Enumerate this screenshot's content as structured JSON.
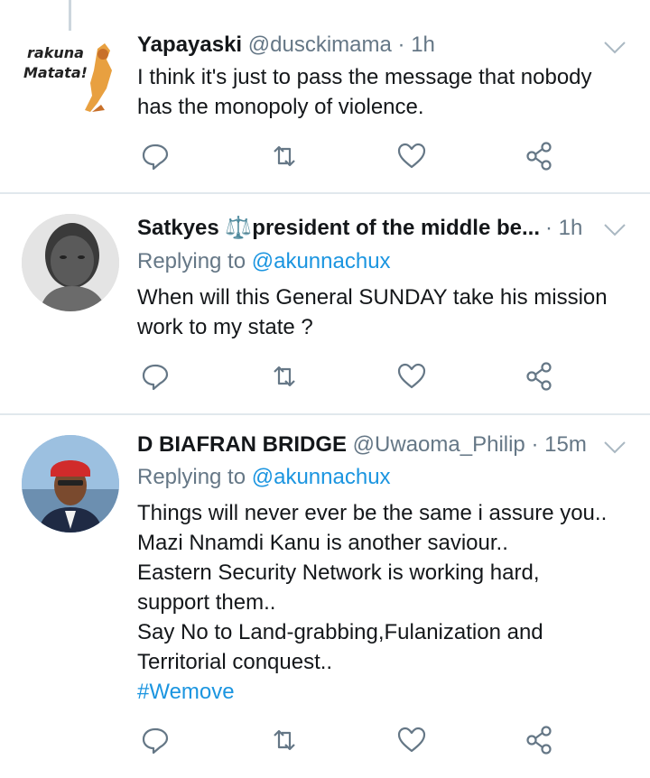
{
  "tweets": [
    {
      "name": "Yapayaski",
      "handle": "@dusckimama",
      "time": "1h",
      "avatar_text_1": "rakuna",
      "avatar_text_2": "Matata!",
      "lines": [
        "I think it's just to pass the message that nobody",
        "has the monopoly of violence."
      ]
    },
    {
      "name": "Satkyes ⚖️president of the middle be...",
      "handle": "",
      "time": "1h",
      "reply_prefix": "Replying to",
      "reply_handle": "@akunnachux",
      "lines": [
        "When will this General SUNDAY take his mission",
        "work to my state ?"
      ]
    },
    {
      "name": "D BIAFRAN BRIDGE",
      "handle": "@Uwaoma_Philip",
      "time": "15m",
      "reply_prefix": "Replying to",
      "reply_handle": "@akunnachux",
      "lines": [
        "Things will never ever be the same i assure you..",
        "Mazi Nnamdi Kanu is another saviour..",
        "Eastern Security Network is working hard,",
        "support them..",
        "Say No to Land-grabbing,Fulanization and",
        "Territorial conquest.."
      ],
      "hashtag": "#Wemove"
    }
  ],
  "icons": [
    "reply-icon",
    "retweet-icon",
    "like-icon",
    "share-icon",
    "chevron-down-icon"
  ],
  "colors": {
    "link": "#1b95e0",
    "muted": "#657786",
    "divider": "#e1e8ed"
  }
}
